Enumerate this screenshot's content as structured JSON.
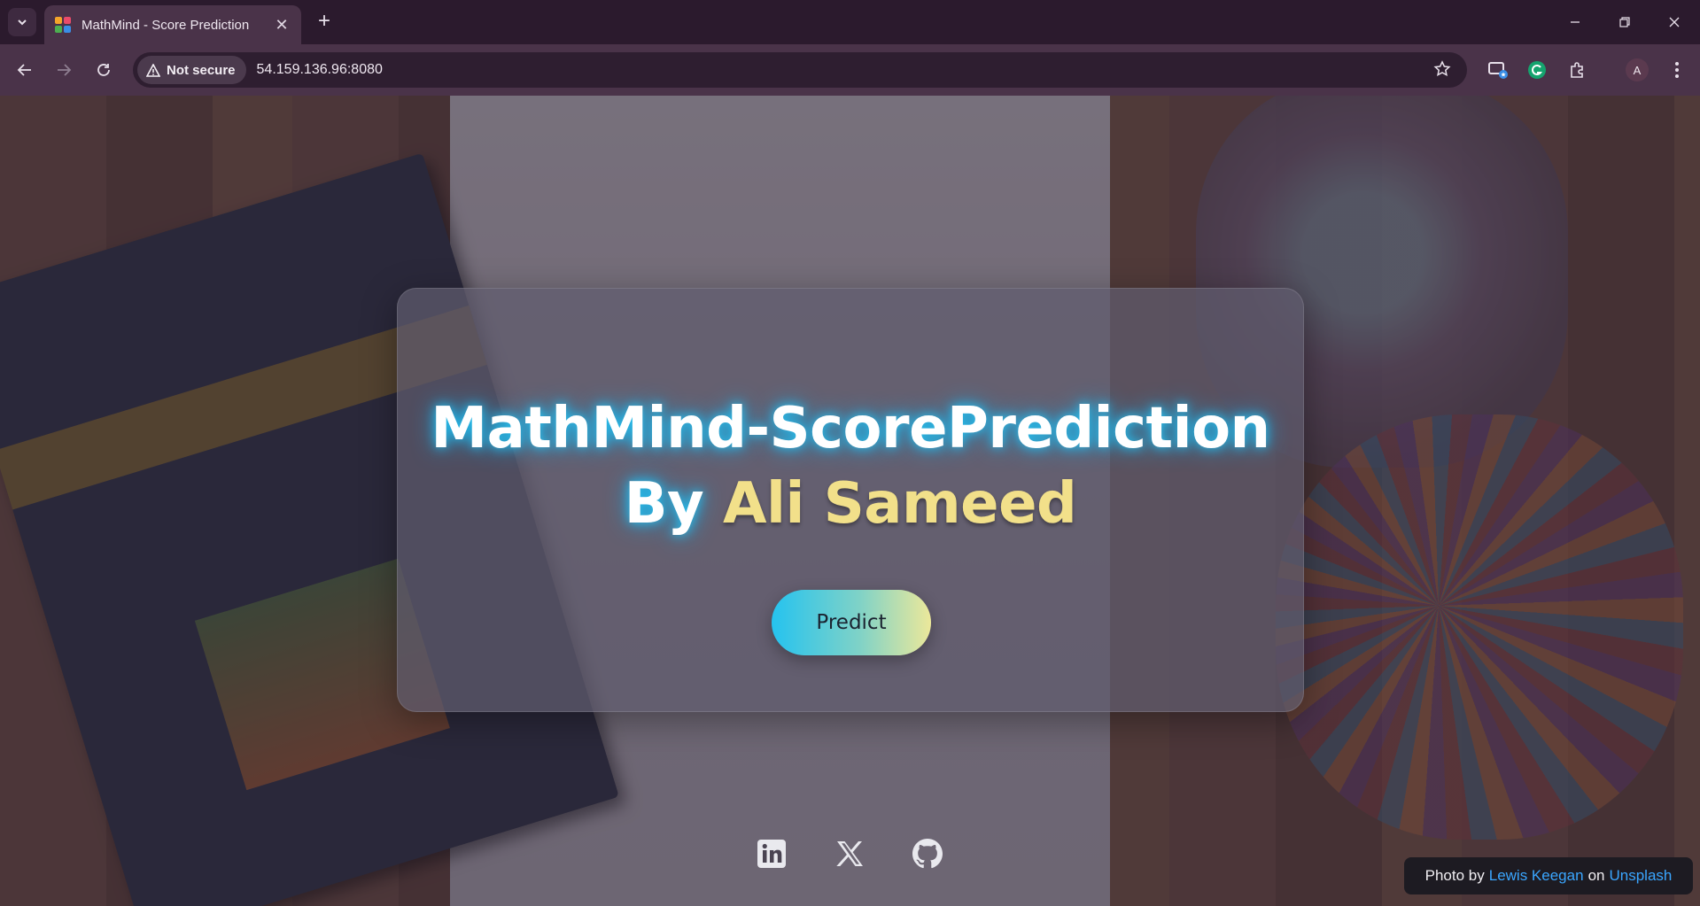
{
  "browser": {
    "tab_title": "MathMind - Score Prediction",
    "security_label": "Not secure",
    "url": "54.159.136.96:8080",
    "profile_initial": "A"
  },
  "hero": {
    "title": "MathMind-ScorePrediction",
    "by_label": "By",
    "author": "Ali Sameed",
    "predict_label": "Predict"
  },
  "social": {
    "icons": [
      "linkedin-icon",
      "x-icon",
      "github-icon"
    ]
  },
  "credit": {
    "prefix": "Photo by",
    "photographer": "Lewis Keegan",
    "on": "on",
    "site": "Unsplash"
  },
  "colors": {
    "glow": "#25c3f2",
    "author": "#f2e08a",
    "link": "#3aa6ff",
    "button_from": "#25c3ef",
    "button_to": "#ece89a"
  }
}
